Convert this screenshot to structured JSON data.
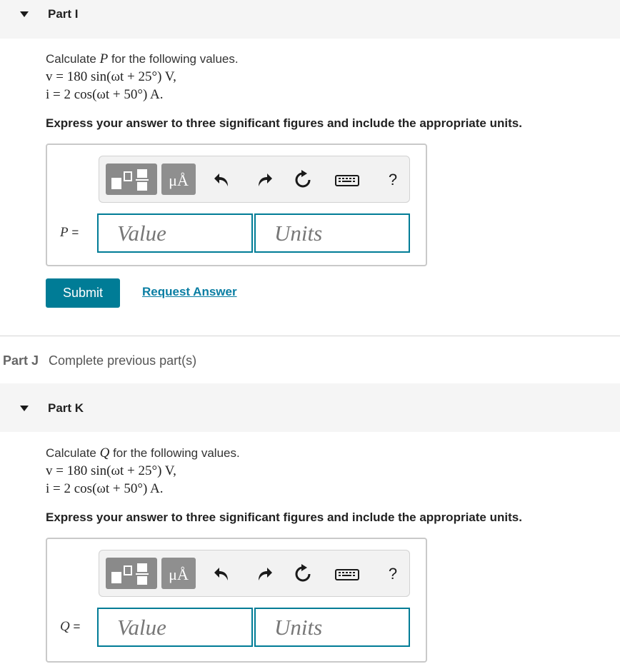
{
  "partI": {
    "title": "Part I",
    "intro_prefix": "Calculate ",
    "intro_var": "P",
    "intro_suffix": " for the following values.",
    "v_line": "v = 180 sin(ωt + 25°) V,",
    "i_line": "i = 2 cos(ωt + 50°) A.",
    "instruction": "Express your answer to three significant figures and include the appropriate units.",
    "answer_label": "P",
    "answer_eq": " =",
    "value_placeholder": "Value",
    "units_placeholder": "Units"
  },
  "toolbar": {
    "units_symbol": "μÅ",
    "help": "?"
  },
  "actions": {
    "submit": "Submit",
    "request": "Request Answer"
  },
  "partJ": {
    "label": "Part J",
    "note": "Complete previous part(s)"
  },
  "partK": {
    "title": "Part K",
    "intro_prefix": "Calculate ",
    "intro_var": "Q",
    "intro_suffix": " for the following values.",
    "v_line": "v = 180 sin(ωt + 25°) V,",
    "i_line": "i = 2 cos(ωt + 50°) A.",
    "instruction": "Express your answer to three significant figures and include the appropriate units.",
    "answer_label": "Q",
    "answer_eq": " =",
    "value_placeholder": "Value",
    "units_placeholder": "Units"
  }
}
